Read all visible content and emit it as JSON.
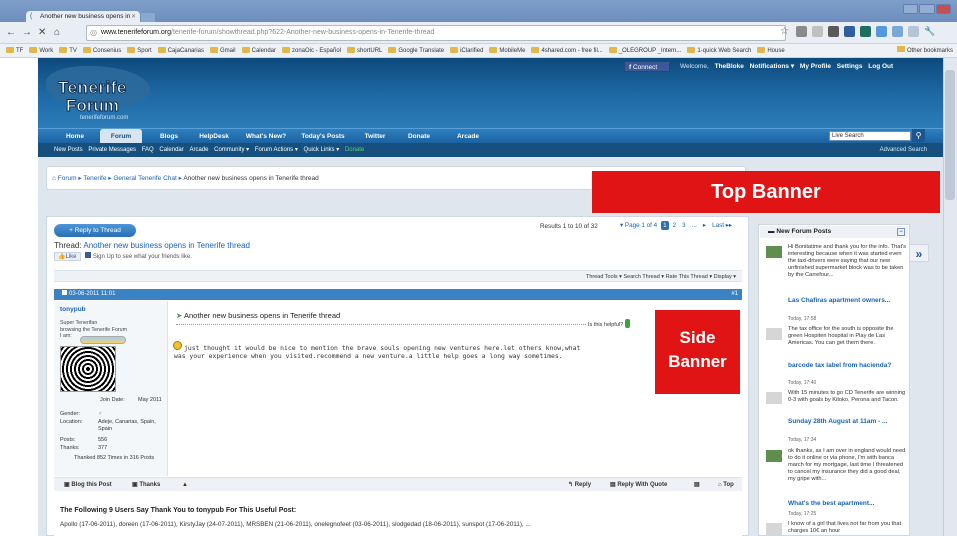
{
  "browser": {
    "tab_title": "Another new business opens in",
    "url_host": "www.tenerifeforum.org",
    "url_path": "/tenerife-forum/showthread.php?622-Another-new-business-opens-in-Tenerife-thread",
    "bookmarks": [
      "TF",
      "Work",
      "TV",
      "Consenius",
      "Sport",
      "CajaCanarias",
      "Gmail",
      "Calendar",
      "zonaOic - Español",
      "shortURL",
      "Google Translate",
      "iClarified",
      "MobileMe",
      "4shared.com - free fil...",
      "_OLEGROUP _Intern...",
      "1-quick Web Search",
      "House"
    ],
    "other_bookmarks": "Other bookmarks"
  },
  "site": {
    "logo_line1": "Tenerife",
    "logo_line2": "Forum",
    "logo_url": "tenerifeforum.com",
    "connect": "Connect",
    "welcome": "Welcome,",
    "username": "TheBloke",
    "notifications": "Notifications ▾",
    "my_profile": "My Profile",
    "settings": "Settings",
    "logout": "Log Out",
    "nav": [
      "Home",
      "Forum",
      "Blogs",
      "HelpDesk",
      "What's New?",
      "Today's Posts",
      "Twitter",
      "Donate",
      "Arcade"
    ],
    "search_placeholder": "Live Search",
    "subnav": [
      "New Posts",
      "Private Messages",
      "FAQ",
      "Calendar",
      "Arcade",
      "Community ▾",
      "Forum Actions ▾",
      "Quick Links ▾"
    ],
    "subnav_green": "Donate",
    "advanced_search": "Advanced Search"
  },
  "breadcrumb": {
    "items": [
      "Forum",
      "Tenerife",
      "General Tenerife Chat"
    ],
    "current": "Another new business opens in Tenerife thread"
  },
  "top_banner": "Top Banner",
  "side_banner_line1": "Side",
  "side_banner_line2": "Banner",
  "thread": {
    "reply_button": "+ Reply to Thread",
    "results": "Results 1 to 10 of 32",
    "page_of": "▾ Page 1 of 4",
    "pages": [
      "1",
      "2",
      "3",
      "...",
      "▸",
      "Last ▸▸"
    ],
    "title_prefix": "Thread:",
    "title": "Another new business opens in Tenerife thread",
    "like": "Like",
    "signup": "Sign Up to see what your friends like.",
    "tools": "Thread Tools ▾    Search Thread ▾    Rate This Thread ▾    Display ▾"
  },
  "post": {
    "date": "03-06-2011 11:01",
    "number": "#1",
    "username": "tonypub",
    "user_title_1": "Super Tenerifan",
    "user_title_2": "browsing the Tenerife Forum",
    "user_title_3": "I am:",
    "join_label": "Join Date:",
    "join_value": "May 2011",
    "gender_label": "Gender:",
    "gender_value": "♂",
    "location_label": "Location:",
    "location_value": "Adeje, Canarias, Spain, Spain",
    "posts_label": "Posts:",
    "posts_value": "556",
    "thanks_label": "Thanks:",
    "thanks_value": "377",
    "thanked": "Thanked 852 Times in 316 Posts",
    "title": "Another new business opens in Tenerife thread",
    "helpful": "Is this helpful?",
    "body": "just thought it would be nice to mention the brave souls opening new ventures here.let others know,what was your experience when you visited.recommend a new venture.a little help goes a long way sometimes.",
    "blog_this": "Blog this Post",
    "thanks_btn": "Thanks",
    "reply": "Reply",
    "reply_quote": "Reply With Quote",
    "top": "Top"
  },
  "thanks_section": {
    "heading": "The Following 9 Users Say Thank You to tonypub For This Useful Post:",
    "list": "Apollo (17-06-2011), doreen (17-06-2011), KirstyJay (24-07-2011), MRSBEN (21-06-2011), onelegnofeet (03-06-2011), slodgedad (18-06-2011), sunspot (17-06-2011), ..."
  },
  "sidebar": {
    "heading": "New Forum Posts",
    "items": [
      {
        "text": "Hi Bonitatime and thank you for the info. That's interesting because when it was started even the taxi-drivers were saying that our new unfinished supermarket block was to be taken by the Carrefour...",
        "title": "Las Chafiras apartment owners...",
        "time": "Today, 17:58"
      },
      {
        "text": "The tax office for the south is opposite the green Hospiten hospital in Play de Las Americas. You can get them there.",
        "title": "barcode tax label from hacienda?",
        "time": "Today, 17:40"
      },
      {
        "text": "With 15 minutes to go CD Tenerife are winning 0-3 with goals by Kitoko, Perona and Tacon.",
        "title": "Sunday 28th August at 11am - ...",
        "time": "Today, 17:34"
      },
      {
        "text": "ok thanks, as I am over in england would need to do it online or via phone, I'm with banca march for my mortgage, last time I threatened to cancel my insurance they did a good deal, my gripe with...",
        "title": "What's the best apartment...",
        "time": "Today, 17:25"
      },
      {
        "text": "I know of a girl that lives not far from you that charges 10€ an hour",
        "title": "",
        "time": ""
      }
    ]
  },
  "colors": {
    "banner_red": "#e01414",
    "nav_blue": "#1c62a0",
    "link_blue": "#1a63b5"
  }
}
